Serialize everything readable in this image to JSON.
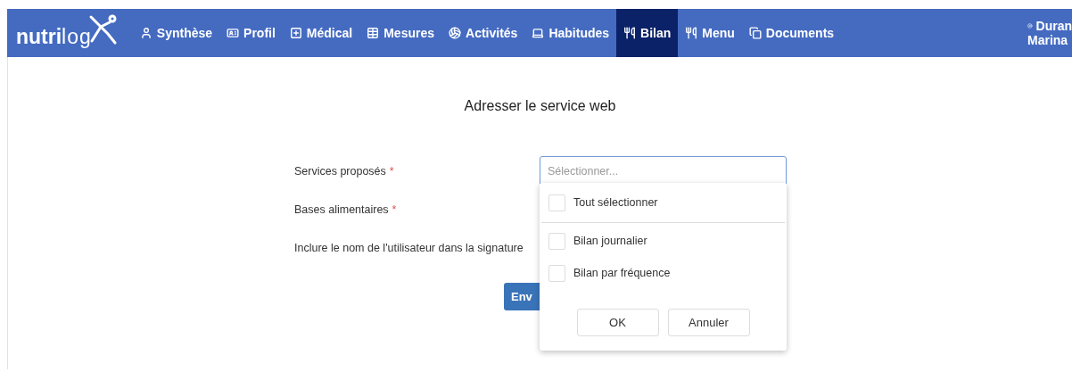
{
  "navbar": {
    "logo": {
      "bold": "nutri",
      "light": "log"
    },
    "items": [
      {
        "label": "Synthèse",
        "selected": false
      },
      {
        "label": "Profil",
        "selected": false
      },
      {
        "label": "Médical",
        "selected": false
      },
      {
        "label": "Mesures",
        "selected": false
      },
      {
        "label": "Activités",
        "selected": false
      },
      {
        "label": "Habitudes",
        "selected": false
      },
      {
        "label": "Bilan",
        "selected": true
      },
      {
        "label": "Menu",
        "selected": false
      },
      {
        "label": "Documents",
        "selected": false
      }
    ],
    "user": {
      "last_name": "Duran",
      "first_name": "Marina"
    }
  },
  "form": {
    "title": "Adresser le service web",
    "fields": [
      {
        "label": "Services proposés",
        "required_mark": "*"
      },
      {
        "label": "Bases alimentaires",
        "required_mark": "*"
      },
      {
        "label": "Inclure le nom de l'utilisateur dans la signature"
      }
    ],
    "select": {
      "placeholder": "Sélectionner..."
    },
    "submit": "Env"
  },
  "dropdown": {
    "select_all": {
      "label": "Tout sélectionner",
      "checked": false
    },
    "options": [
      {
        "label": "Bilan journalier",
        "checked": false
      },
      {
        "label": "Bilan par fréquence",
        "checked": false
      }
    ],
    "buttons": [
      "OK",
      "Annuler"
    ]
  }
}
